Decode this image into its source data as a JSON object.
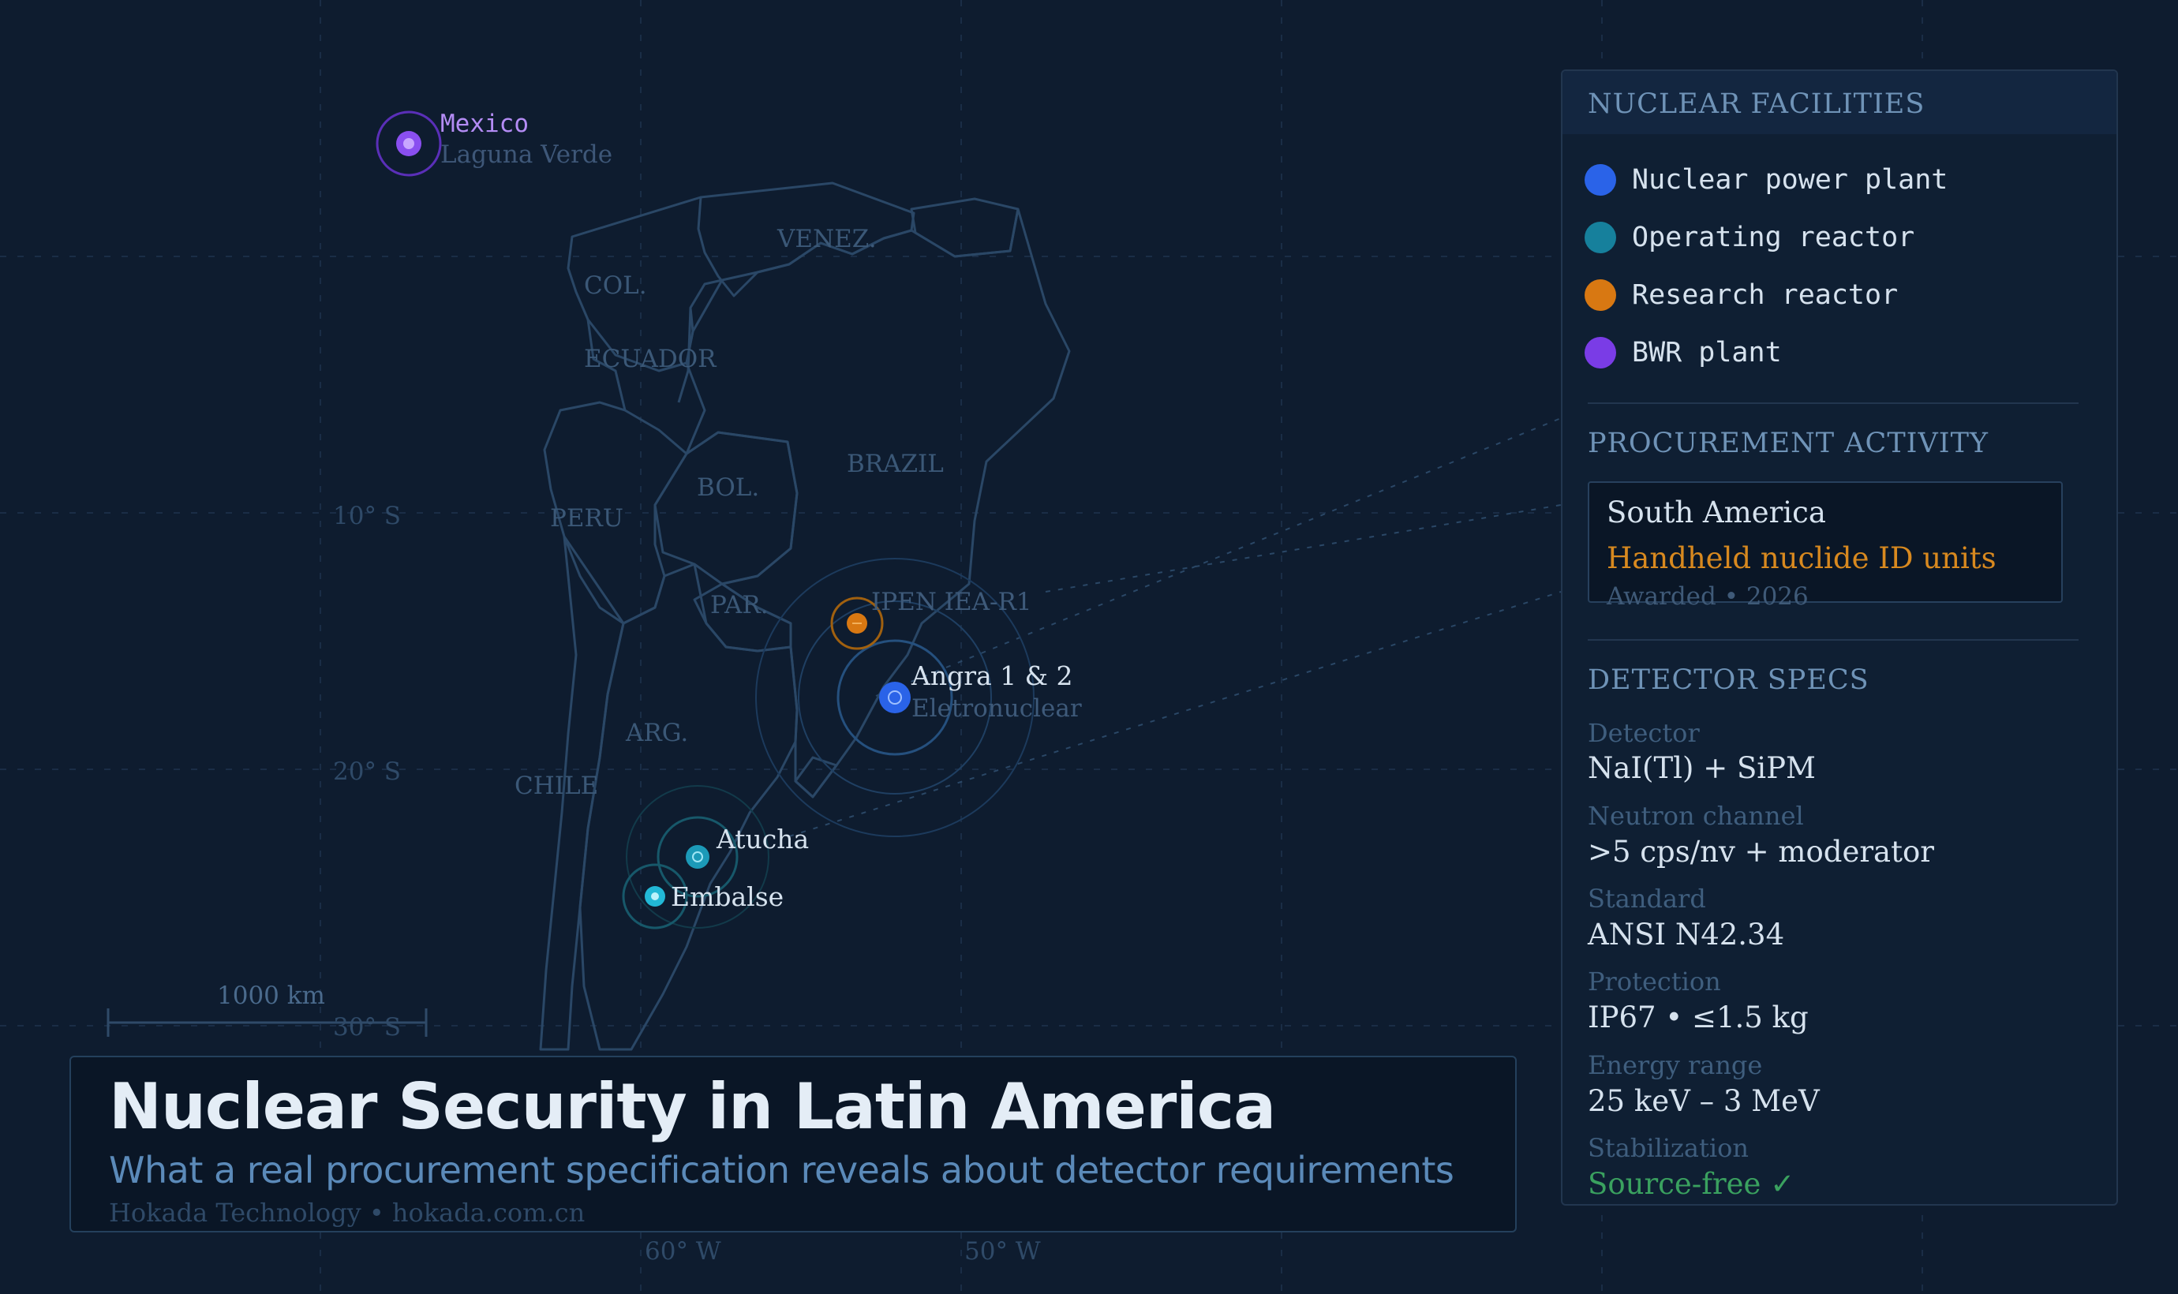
{
  "map": {
    "country_labels": [
      "VENEZ.",
      "COL.",
      "ECUADOR",
      "PERU",
      "BOL.",
      "BRAZIL",
      "PAR.",
      "ARG.",
      "CHILE"
    ],
    "lat_labels": [
      "10° S",
      "20° S",
      "30° S"
    ],
    "lon_labels": [
      "60° W",
      "50° W"
    ],
    "scale_label": "1000 km",
    "sites": [
      {
        "name": "Mexico",
        "sub": "Laguna Verde",
        "type": "bwr"
      },
      {
        "name": "IPEN IEA-R1",
        "sub": "",
        "type": "research"
      },
      {
        "name": "Angra 1 & 2",
        "sub": "Eletronuclear",
        "type": "npp"
      },
      {
        "name": "Atucha",
        "sub": "",
        "type": "operating"
      },
      {
        "name": "Embalse",
        "sub": "",
        "type": "operating"
      }
    ]
  },
  "colors": {
    "npp": "#2a63e8",
    "operating": "#16809c",
    "research": "#d87812",
    "bwr": "#7a3ce6",
    "site_cyan": "#22b8d6",
    "accent_orange": "#d8891f",
    "accent_green": "#3aa15f"
  },
  "panel": {
    "facilities_title": "NUCLEAR FACILITIES",
    "legend": [
      {
        "label": "Nuclear power plant",
        "color": "#2a63e8"
      },
      {
        "label": "Operating reactor",
        "color": "#16809c"
      },
      {
        "label": "Research reactor",
        "color": "#d87812"
      },
      {
        "label": "BWR plant",
        "color": "#7a3ce6"
      }
    ],
    "procurement_title": "PROCUREMENT ACTIVITY",
    "procurement": {
      "region": "South America",
      "item": "Handheld nuclide ID units",
      "meta": "Awarded • 2026"
    },
    "specs_title": "DETECTOR SPECS",
    "specs": [
      {
        "label": "Detector",
        "value": "NaI(Tl) + SiPM"
      },
      {
        "label": "Neutron channel",
        "value": ">5 cps/nv + moderator"
      },
      {
        "label": "Standard",
        "value": "ANSI N42.34"
      },
      {
        "label": "Protection",
        "value": "IP67 • ≤1.5 kg"
      },
      {
        "label": "Energy range",
        "value": "25 keV – 3 MeV"
      },
      {
        "label": "Stabilization",
        "value": "Source-free ✓"
      }
    ]
  },
  "header": {
    "title": "Nuclear Security in Latin America",
    "subtitle": "What a real procurement specification reveals about detector requirements",
    "credit": "Hokada Technology • hokada.com.cn"
  }
}
